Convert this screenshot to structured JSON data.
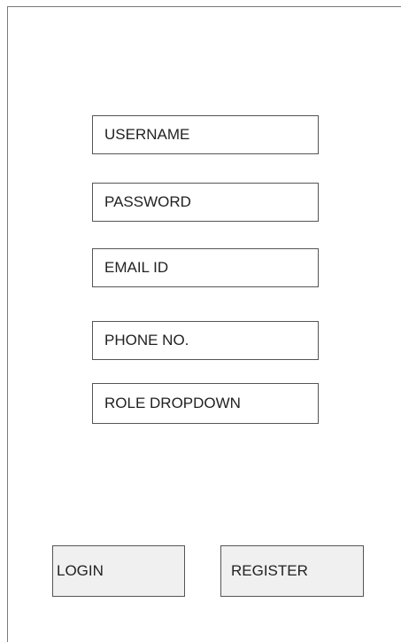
{
  "form": {
    "username_placeholder": "USERNAME",
    "password_placeholder": "PASSWORD",
    "email_placeholder": "EMAIL ID",
    "phone_placeholder": "PHONE NO.",
    "role_dropdown_label": "ROLE DROPDOWN"
  },
  "actions": {
    "login_label": "LOGIN",
    "register_label": "REGISTER"
  },
  "colors": {
    "border": "#555555",
    "button_background": "#f0f0f0",
    "frame_line": "#7a7a7a"
  }
}
